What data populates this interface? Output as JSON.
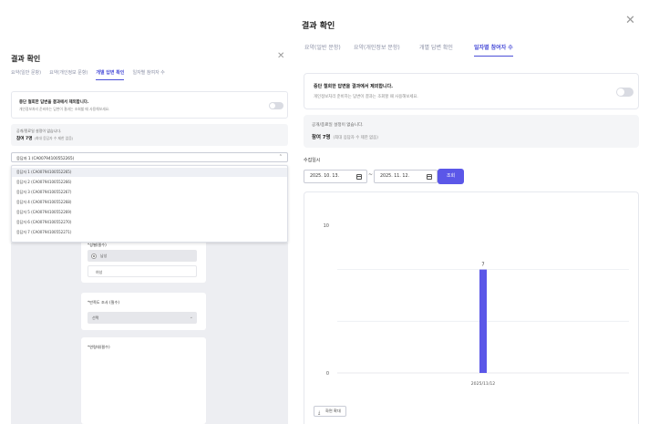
{
  "left": {
    "title": "결과 확인",
    "tabs": [
      {
        "label": "요약(일반 문항)",
        "active": false
      },
      {
        "label": "요약(개인정보 문항)",
        "active": false
      },
      {
        "label": "개별 답변 확인",
        "active": true
      },
      {
        "label": "일자별 참여자 수",
        "active": false
      }
    ],
    "notice_title": "중단 철회한 답변을 결과에서 제외합니다.",
    "notice_desc": "개인정보처리 준비하는 답변이 결과는 조회할 때 사용해보세요.",
    "info_line1": "공개/종료일 설정이 없습니다.",
    "info_line2": "참여 7명",
    "info_line2_sub": "(최대 응답자 수 제한 없음)",
    "select_value": "응답자 1 (CA00794100552265)",
    "dropdown_options": [
      "응답자 1 (CA00794100552265)",
      "응답자 2 (CA00794100552266)",
      "응답자 3 (CA00794100552267)",
      "응답자 4 (CA00794100552268)",
      "응답자 5 (CA00794100552269)",
      "응답자 6 (CA00794100552270)",
      "응답자 7 (CA00794100552271)"
    ],
    "q_gender": "*성별(필수)",
    "radio_male": "남성",
    "radio_female": "여성",
    "q_satisfaction": "*만족도 조사 (필수)",
    "satisfaction_value": "선택",
    "q_age": "*연령대(필수)"
  },
  "right": {
    "title": "결과 확인",
    "tabs": [
      {
        "label": "요약(일반 문항)",
        "active": false
      },
      {
        "label": "요약(개인정보 문항)",
        "active": false
      },
      {
        "label": "개별 답변 확인",
        "active": false
      },
      {
        "label": "일자별 참여자 수",
        "active": true
      }
    ],
    "notice_title": "중단 철회한 답변을 결과에서 제외합니다.",
    "notice_desc": "개인정보처리 준비하는 답변이 결과는 조회할 때 사용해보세요.",
    "info_line1": "공개/종료일 설정이 없습니다.",
    "info_line2": "참여 7명",
    "info_line2_sub": "(최대 응답자 수 제한 없음)",
    "period_label": "수집일시",
    "date_from": "2025. 10. 13.",
    "date_to": "2025. 11. 12.",
    "search_button": "조회",
    "fullscreen_button": "화면 확대"
  },
  "colors": {
    "accent": "#5b57e8",
    "bar": "#5b57e8"
  },
  "chart_data": {
    "type": "bar",
    "categories": [
      "2025/11/12"
    ],
    "values": [
      7
    ],
    "ylim": [
      0,
      10
    ],
    "yticks": [
      0,
      10
    ],
    "data_labels": [
      "7"
    ],
    "grid": true
  }
}
